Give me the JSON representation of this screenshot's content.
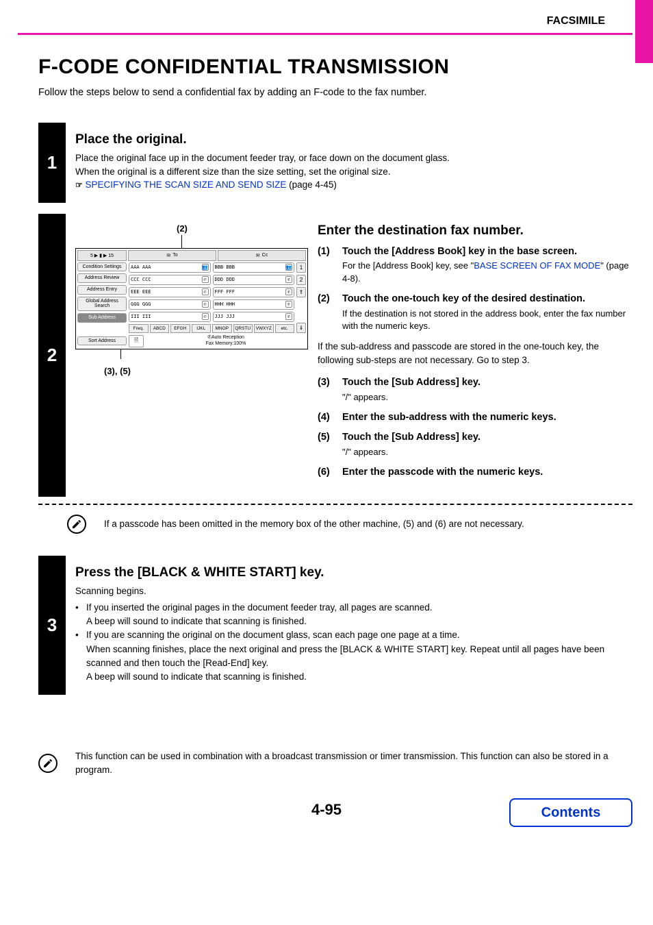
{
  "header": {
    "section": "FACSIMILE"
  },
  "title": "F-CODE CONFIDENTIAL TRANSMISSION",
  "intro": "Follow the steps below to send a confidential fax by adding an F-code to the fax number.",
  "step1": {
    "num": "1",
    "title": "Place the original.",
    "line1": "Place the original face up in the document feeder tray, or face down on the document glass.",
    "line2": "When the original is a different size than the size setting, set the original size.",
    "pointer": "☞",
    "link": "SPECIFYING THE SCAN SIZE AND SEND SIZE",
    "pageref": " (page 4-45)"
  },
  "step2": {
    "num": "2",
    "callouts": {
      "top": "(2)",
      "bottom": "(3), (5)"
    },
    "panel": {
      "top_tabs": {
        "range": "5 ▶ ▮ ▶ 15",
        "to": "To",
        "cc": "Cc"
      },
      "left": [
        "Condition Settings",
        "Address Review",
        "Address Entry",
        "Global Address Search",
        "Sub Address"
      ],
      "entries": [
        [
          "AAA AAA",
          "BBB BBB"
        ],
        [
          "CCC CCC",
          "DDD DDD"
        ],
        [
          "EEE EEE",
          "FFF FFF"
        ],
        [
          "GGG GGG",
          "HHH HHH"
        ],
        [
          "III III",
          "JJJ JJJ"
        ]
      ],
      "side": [
        "1",
        "2",
        "⇑",
        "⇓"
      ],
      "freq": [
        "Freq.",
        "ABCD",
        "EFGH",
        "IJKL",
        "MNOP",
        "QRSTU",
        "VWXYZ",
        "etc."
      ],
      "sort": "Sort Address",
      "status1": "Auto Reception",
      "status2": "Fax Memory:100%"
    },
    "heading": "Enter the destination fax number.",
    "items": [
      {
        "n": "(1)",
        "t": "Touch the [Address Book] key in the base screen.",
        "sub_pre": "For the [Address Book] key, see \"",
        "sub_link": "BASE SCREEN OF FAX MODE",
        "sub_post": "\" (page 4-8)."
      },
      {
        "n": "(2)",
        "t": "Touch the one-touch key of the desired destination.",
        "sub": "If the destination is not stored in the address book, enter the fax number with the numeric keys."
      }
    ],
    "midnote": "If the sub-address and passcode are stored in the one-touch key, the following sub-steps are not necessary. Go to step 3.",
    "items2": [
      {
        "n": "(3)",
        "t": "Touch the [Sub Address] key.",
        "sub": "\"/\" appears."
      },
      {
        "n": "(4)",
        "t": "Enter the sub-address with the numeric keys."
      },
      {
        "n": "(5)",
        "t": "Touch the [Sub Address] key.",
        "sub": "\"/\" appears."
      },
      {
        "n": "(6)",
        "t": "Enter the passcode with the numeric keys."
      }
    ],
    "note": "If a passcode has been omitted in the memory box of the other machine, (5) and (6) are not necessary."
  },
  "step3": {
    "num": "3",
    "title": "Press the [BLACK & WHITE START] key.",
    "lead": "Scanning begins.",
    "b1a": "If you inserted the original pages in the document feeder tray, all pages are scanned.",
    "b1b": "A beep will sound to indicate that scanning is finished.",
    "b2a": "If you are scanning the original on the document glass, scan each page one page at a time.",
    "b2b": "When scanning finishes, place the next original and press the [BLACK & WHITE START] key. Repeat until all pages have been scanned and then touch the [Read-End] key.",
    "b2c": "A beep will sound to indicate that scanning is finished."
  },
  "bottom_note": "This function can be used in combination with a broadcast transmission or timer transmission. This function can also be stored in a program.",
  "page_number": "4-95",
  "contents_button": "Contents"
}
